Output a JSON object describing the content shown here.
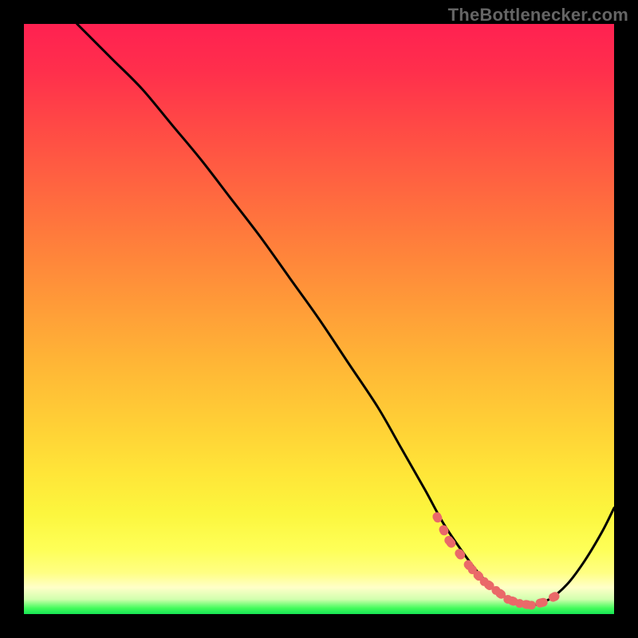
{
  "watermark": "TheBottlenecker.com",
  "chart_data": {
    "type": "line",
    "title": "",
    "xlabel": "",
    "ylabel": "",
    "xlim": [
      0,
      100
    ],
    "ylim": [
      0,
      100
    ],
    "series": [
      {
        "name": "curve",
        "x": [
          9,
          12,
          15,
          20,
          25,
          30,
          35,
          40,
          45,
          50,
          55,
          60,
          64,
          68,
          71,
          74,
          77,
          80,
          83,
          86,
          89,
          92,
          95,
          98,
          100
        ],
        "y": [
          100,
          97,
          94,
          89,
          83,
          77,
          70.5,
          64,
          57,
          50,
          42.5,
          35,
          28,
          21,
          15.5,
          11,
          7,
          4,
          2.2,
          1.5,
          2.5,
          5,
          9,
          14,
          18
        ],
        "color": "#000000"
      },
      {
        "name": "markers",
        "x": [
          70,
          72,
          74,
          76,
          78,
          80,
          82,
          84,
          86,
          88,
          90
        ],
        "y": [
          16.5,
          12.5,
          10,
          7.5,
          5.5,
          4,
          2.5,
          1.8,
          1.5,
          2,
          3
        ],
        "color": "#ea6969"
      }
    ],
    "gradient_stops": [
      {
        "offset": 0.0,
        "color": "#ff2151"
      },
      {
        "offset": 0.08,
        "color": "#ff2f4c"
      },
      {
        "offset": 0.18,
        "color": "#ff4b45"
      },
      {
        "offset": 0.28,
        "color": "#ff6640"
      },
      {
        "offset": 0.38,
        "color": "#ff813b"
      },
      {
        "offset": 0.48,
        "color": "#ff9c38"
      },
      {
        "offset": 0.58,
        "color": "#ffb736"
      },
      {
        "offset": 0.68,
        "color": "#ffd036"
      },
      {
        "offset": 0.76,
        "color": "#ffe538"
      },
      {
        "offset": 0.83,
        "color": "#fcf63e"
      },
      {
        "offset": 0.89,
        "color": "#feff57"
      },
      {
        "offset": 0.93,
        "color": "#ffff83"
      },
      {
        "offset": 0.955,
        "color": "#ffffc8"
      },
      {
        "offset": 0.975,
        "color": "#d1ffae"
      },
      {
        "offset": 0.99,
        "color": "#43fb5c"
      },
      {
        "offset": 1.0,
        "color": "#16e454"
      }
    ]
  }
}
